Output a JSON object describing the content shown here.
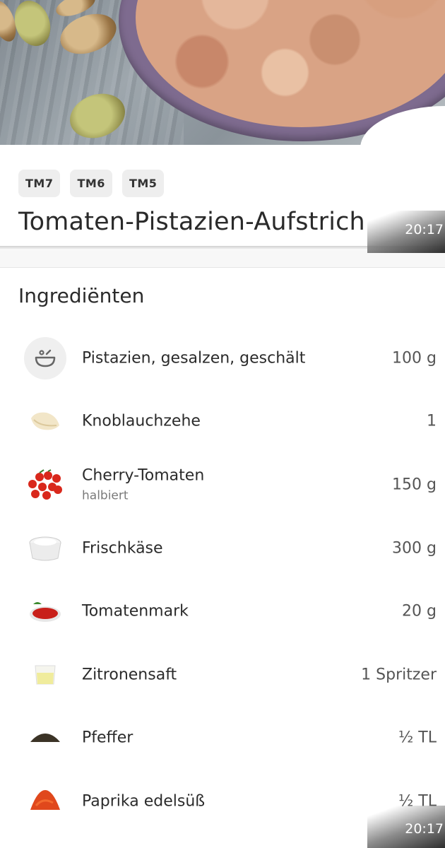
{
  "recipe": {
    "tags": [
      "TM7",
      "TM6",
      "TM5"
    ],
    "title": "Tomaten-Pistazien-Aufstrich"
  },
  "status": {
    "time": "20:17"
  },
  "ingredients": {
    "heading": "Ingrediënten",
    "items": [
      {
        "icon": "bowl-icon",
        "name": "Pistazien, gesalzen, geschält",
        "note": "",
        "qty": "100 g"
      },
      {
        "icon": "garlic-icon",
        "name": "Knoblauchzehe",
        "note": "",
        "qty": "1"
      },
      {
        "icon": "cherry-tomatoes-icon",
        "name": "Cherry-Tomaten",
        "note": "halbiert",
        "qty": "150 g"
      },
      {
        "icon": "cream-cheese-icon",
        "name": "Frischkäse",
        "note": "",
        "qty": "300 g"
      },
      {
        "icon": "tomato-paste-icon",
        "name": "Tomatenmark",
        "note": "",
        "qty": "20 g"
      },
      {
        "icon": "lemon-juice-icon",
        "name": "Zitronensaft",
        "note": "",
        "qty": "1 Spritzer"
      },
      {
        "icon": "pepper-icon",
        "name": "Pfeffer",
        "note": "",
        "qty": "½ TL"
      },
      {
        "icon": "paprika-icon",
        "name": "Paprika edelsüß",
        "note": "",
        "qty": "½ TL"
      }
    ]
  }
}
